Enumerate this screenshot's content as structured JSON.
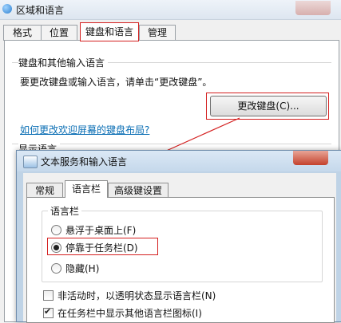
{
  "outer": {
    "title": "区域和语言",
    "tabs": [
      "格式",
      "位置",
      "键盘和语言",
      "管理"
    ],
    "group_title": "键盘和其他输入语言",
    "instruction": "要更改键盘或输入语言，请单击“更改键盘”。",
    "change_keyboard_button": "更改键盘(C)...",
    "link": "如何更改欢迎屏幕的键盘布局?",
    "partial_group_title": "显示语言"
  },
  "inner": {
    "title": "文本服务和输入语言",
    "tabs": [
      "常规",
      "语言栏",
      "高级键设置"
    ],
    "group_title": "语言栏",
    "radios": [
      {
        "label": "悬浮于桌面上(F)",
        "checked": false
      },
      {
        "label": "停靠于任务栏(D)",
        "checked": true
      },
      {
        "label": "隐藏(H)",
        "checked": false
      }
    ],
    "checkboxes": [
      {
        "label": "非活动时，以透明状态显示语言栏(N)",
        "checked": false
      },
      {
        "label": "在任务栏中显示其他语言栏图标(I)",
        "checked": true
      }
    ]
  },
  "annotation_color": "#d42020"
}
